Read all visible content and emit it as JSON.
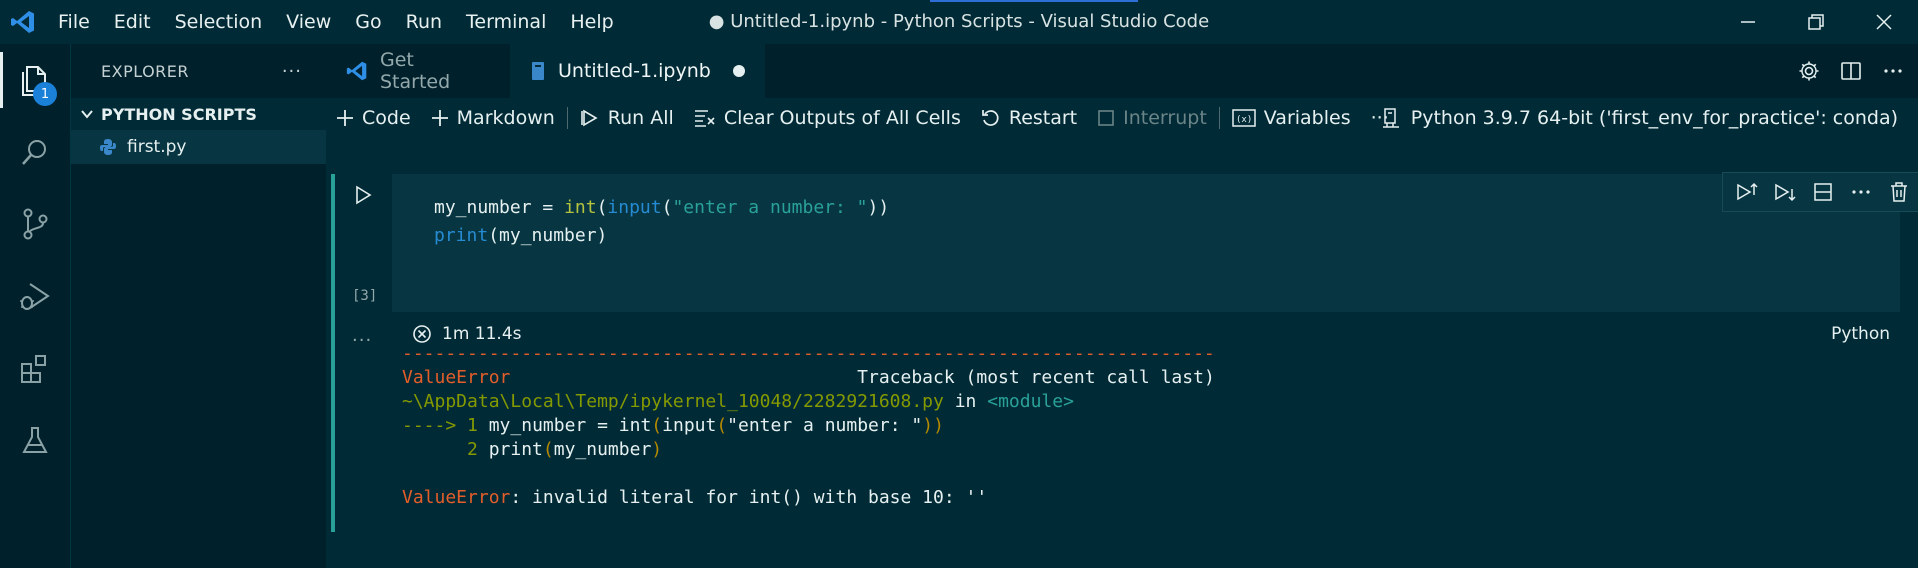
{
  "window": {
    "title": "● Untitled-1.ipynb - Python Scripts - Visual Studio Code"
  },
  "menu": [
    "File",
    "Edit",
    "Selection",
    "View",
    "Go",
    "Run",
    "Terminal",
    "Help"
  ],
  "activity": {
    "explorer_badge": "1"
  },
  "sidebar": {
    "title": "EXPLORER",
    "more": "···",
    "section": "PYTHON SCRIPTS",
    "files": [
      "first.py"
    ]
  },
  "tabs": [
    {
      "label": "Get Started",
      "active": false
    },
    {
      "label": "Untitled-1.ipynb",
      "active": true,
      "dirty": true
    }
  ],
  "toolbar": {
    "code": "Code",
    "markdown": "Markdown",
    "run_all": "Run All",
    "clear_outputs": "Clear Outputs of All Cells",
    "restart": "Restart",
    "interrupt": "Interrupt",
    "variables": "Variables",
    "more": "···",
    "kernel": "Python 3.9.7 64-bit ('first_env_for_practice': conda)"
  },
  "cell": {
    "execution_count": "[3]",
    "code_lines": [
      "my_number = int(input(\"enter a number: \"))",
      "print(my_number)"
    ],
    "status_time": "1m 11.4s",
    "language": "Python",
    "output_more": "···"
  },
  "output": {
    "dashes": "---------------------------------------------------------------------------",
    "error_name": "ValueError",
    "traceback_header": "Traceback (most recent call last)",
    "file_path": "~\\AppData\\Local\\Temp/ipykernel_10048/2282921608.py",
    "in_word": "in",
    "module": "<module>",
    "arrow": "---->",
    "line1_no": "1",
    "line2_no": "2",
    "line1_code": "my_number = int(input(\"enter a number: \"))",
    "line2_code": "print(my_number)",
    "final_error": "ValueError",
    "final_message": ": invalid literal for int() with base 10: ''"
  },
  "colors": {
    "background": "#002b36",
    "accent": "#2aa198",
    "error": "#e35d2a",
    "badge": "#1b80d8"
  }
}
